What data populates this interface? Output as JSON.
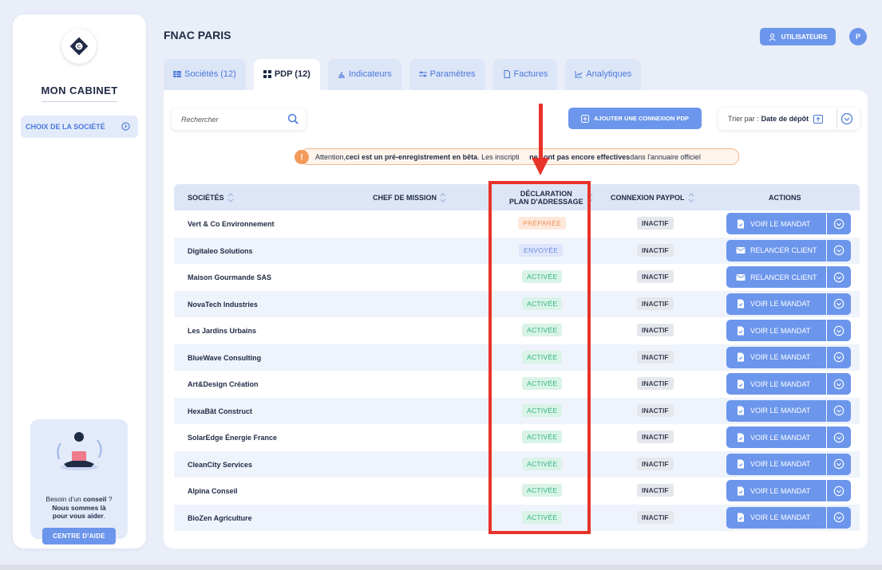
{
  "sidebar": {
    "brand": "MON CABINET",
    "choice_label": "CHOIX DE LA SOCIÉTÉ",
    "help": {
      "line1_pre": "Besoin d'un ",
      "line1_bold": "conseil",
      "line1_post": " ?",
      "line2": "Nous sommes là",
      "line3_pre": "pour vous ",
      "line3_bold": "aider",
      "line3_post": ".",
      "button": "CENTRE D'AIDE"
    }
  },
  "header": {
    "title": "FNAC PARIS",
    "users_button": "UTILISATEURS",
    "avatar_initial": "P"
  },
  "tabs": [
    {
      "label": "Sociétés (12)",
      "icon": "table-icon",
      "active": false
    },
    {
      "label": "PDP (12)",
      "icon": "grid-icon",
      "active": true
    },
    {
      "label": "Indicateurs",
      "icon": "bar-chart-icon",
      "active": false
    },
    {
      "label": "Paramètres",
      "icon": "sliders-icon",
      "active": false
    },
    {
      "label": "Factures",
      "icon": "document-icon",
      "active": false
    },
    {
      "label": "Analytiques",
      "icon": "line-chart-icon",
      "active": false
    }
  ],
  "toolbar": {
    "search_placeholder": "Rechercher",
    "add_button": "AJOUTER UNE CONNEXION PDP",
    "sort_prefix": "Trier par :",
    "sort_value": "Date de dépôt"
  },
  "warning": {
    "part1": "Attention, ",
    "part2_bold": "ceci est un pré-enregistrement en bêta",
    "part3": ". Les inscripti",
    "part4_bold": "ne sont pas encore effectives",
    "part5": " dans l'annuaire officiel"
  },
  "table": {
    "columns": {
      "societes": "SOCIÉTÉS",
      "chef": "CHEF DE MISSION",
      "declaration_line1": "DÉCLARATION",
      "declaration_line2": "PLAN D'ADRESSAGE",
      "connexion": "CONNEXION PAYPOL",
      "actions": "ACTIONS"
    },
    "rows": [
      {
        "name": "Vert & Co Environnement",
        "status": "PRÉPARÉE",
        "status_kind": "preparee",
        "connexion": "INACTIF",
        "action": "VOIR LE MANDAT",
        "action_icon": "document-check-icon"
      },
      {
        "name": "Digitaleo Solutions",
        "status": "ENVOYÉE",
        "status_kind": "envoyee",
        "connexion": "INACTIF",
        "action": "RELANCER CLIENT",
        "action_icon": "mail-icon"
      },
      {
        "name": "Maison Gourmande SAS",
        "status": "ACTIVÉE",
        "status_kind": "activee",
        "connexion": "INACTIF",
        "action": "RELANCER CLIENT",
        "action_icon": "mail-icon"
      },
      {
        "name": "NovaTech Industries",
        "status": "ACTIVÉE",
        "status_kind": "activee",
        "connexion": "INACTIF",
        "action": "VOIR LE MANDAT",
        "action_icon": "document-check-icon"
      },
      {
        "name": "Les Jardins Urbains",
        "status": "ACTIVÉE",
        "status_kind": "activee",
        "connexion": "INACTIF",
        "action": "VOIR LE MANDAT",
        "action_icon": "document-check-icon"
      },
      {
        "name": "BlueWave Consulting",
        "status": "ACTIVÉE",
        "status_kind": "activee",
        "connexion": "INACTIF",
        "action": "VOIR LE MANDAT",
        "action_icon": "document-check-icon"
      },
      {
        "name": "Art&Design Création",
        "status": "ACTIVÉE",
        "status_kind": "activee",
        "connexion": "INACTIF",
        "action": "VOIR LE MANDAT",
        "action_icon": "document-check-icon"
      },
      {
        "name": "HexaBât Construct",
        "status": "ACTIVÉE",
        "status_kind": "activee",
        "connexion": "INACTIF",
        "action": "VOIR LE MANDAT",
        "action_icon": "document-check-icon"
      },
      {
        "name": "SolarEdge Énergie France",
        "status": "ACTIVÉE",
        "status_kind": "activee",
        "connexion": "INACTIF",
        "action": "VOIR LE MANDAT",
        "action_icon": "document-check-icon"
      },
      {
        "name": "CleanCity Services",
        "status": "ACTIVÉE",
        "status_kind": "activee",
        "connexion": "INACTIF",
        "action": "VOIR LE MANDAT",
        "action_icon": "document-check-icon"
      },
      {
        "name": "Alpina Conseil",
        "status": "ACTIVÉE",
        "status_kind": "activee",
        "connexion": "INACTIF",
        "action": "VOIR LE MANDAT",
        "action_icon": "document-check-icon"
      },
      {
        "name": "BioZen Agriculture",
        "status": "ACTIVÉE",
        "status_kind": "activee",
        "connexion": "INACTIF",
        "action": "VOIR LE MANDAT",
        "action_icon": "document-check-icon"
      }
    ]
  },
  "colors": {
    "accent": "#6c96ec",
    "highlight_annotation": "#e7332a",
    "status_activee": "#2fb57a",
    "status_preparee": "#f1925a",
    "status_envoyee": "#6c8de0"
  }
}
